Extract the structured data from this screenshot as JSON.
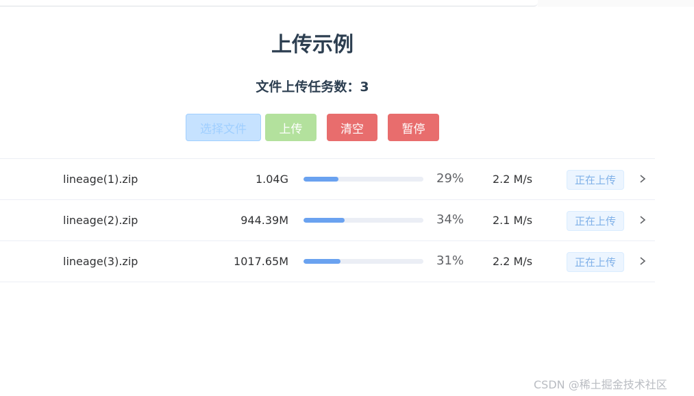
{
  "page": {
    "title": "上传示例",
    "task_count_label": "文件上传任务数：3"
  },
  "toolbar": {
    "select_label": "选择文件",
    "upload_label": "上传",
    "clear_label": "清空",
    "pause_label": "暂停"
  },
  "files": [
    {
      "name": "lineage(1).zip",
      "size": "1.04G",
      "progress": 29,
      "progress_text": "29%",
      "speed": "2.2 M/s",
      "status": "正在上传"
    },
    {
      "name": "lineage(2).zip",
      "size": "944.39M",
      "progress": 34,
      "progress_text": "34%",
      "speed": "2.1 M/s",
      "status": "正在上传"
    },
    {
      "name": "lineage(3).zip",
      "size": "1017.65M",
      "progress": 31,
      "progress_text": "31%",
      "speed": "2.2 M/s",
      "status": "正在上传"
    }
  ],
  "watermark": "CSDN @稀土掘金技术社区",
  "colors": {
    "progress": "#6aa2f0",
    "danger": "#e86d6d",
    "success_light": "#b3e19d",
    "primary_light": "#c6e2ff"
  },
  "icons": {
    "row_action": "chevron-right-icon"
  }
}
